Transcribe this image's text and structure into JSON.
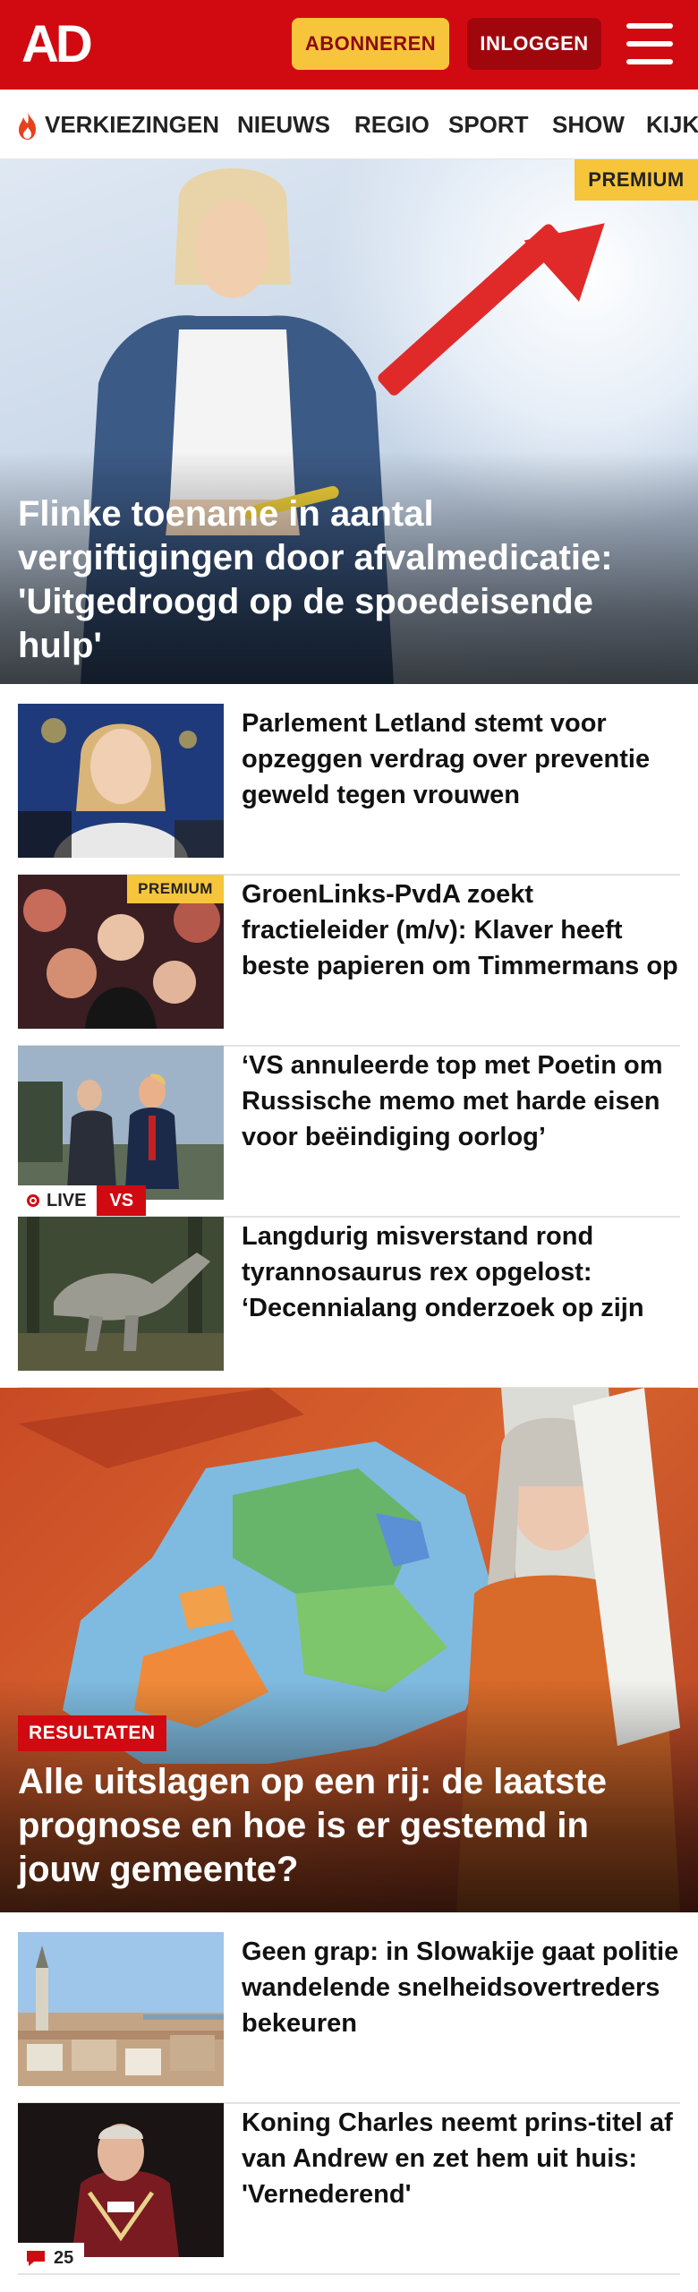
{
  "header": {
    "logo": "AD",
    "subscribe_label": "ABONNEREN",
    "login_label": "INLOGGEN",
    "brand_color": "#d10a11",
    "accent_color": "#f7c53b"
  },
  "nav": {
    "items": [
      "VERKIEZINGEN",
      "NIEUWS",
      "REGIO",
      "SPORT",
      "SHOW",
      "KIJK"
    ]
  },
  "hero": {
    "badge": "PREMIUM",
    "title": "Flinke toename in aantal vergiftigingen door afvalmedicatie: 'Uitgedroogd op de spoedeisende hulp'"
  },
  "articles": [
    {
      "title": "Parlement Letland stemt voor opzeggen verdrag over preventie geweld tegen vrouwen"
    },
    {
      "title": "GroenLinks-PvdA zoekt fractieleider (m/v): Klaver heeft beste papieren om Timmermans op te volgen",
      "badge": "PREMIUM"
    },
    {
      "title": "‘VS annuleerde top met Poetin om Russische memo met harde eisen voor beëindiging oorlog’",
      "live_label": "LIVE",
      "live_tag": "VS"
    },
    {
      "title": "Langdurig misverstand rond tyrannosaurus rex opgelost: ‘Decennialang onderzoek op zijn kop gezet’"
    }
  ],
  "results": {
    "tag": "RESULTATEN",
    "title": "Alle uitslagen op een rij: de laatste prognose en hoe is er gestemd in jouw gemeente?"
  },
  "articles_2": [
    {
      "title": "Geen grap: in Slowakije gaat politie wandelende snelheidsovertreders bekeuren"
    },
    {
      "title": "Koning Charles neemt prins-titel af van Andrew en zet hem uit huis: 'Vernederend'",
      "comment_count": "25"
    }
  ]
}
